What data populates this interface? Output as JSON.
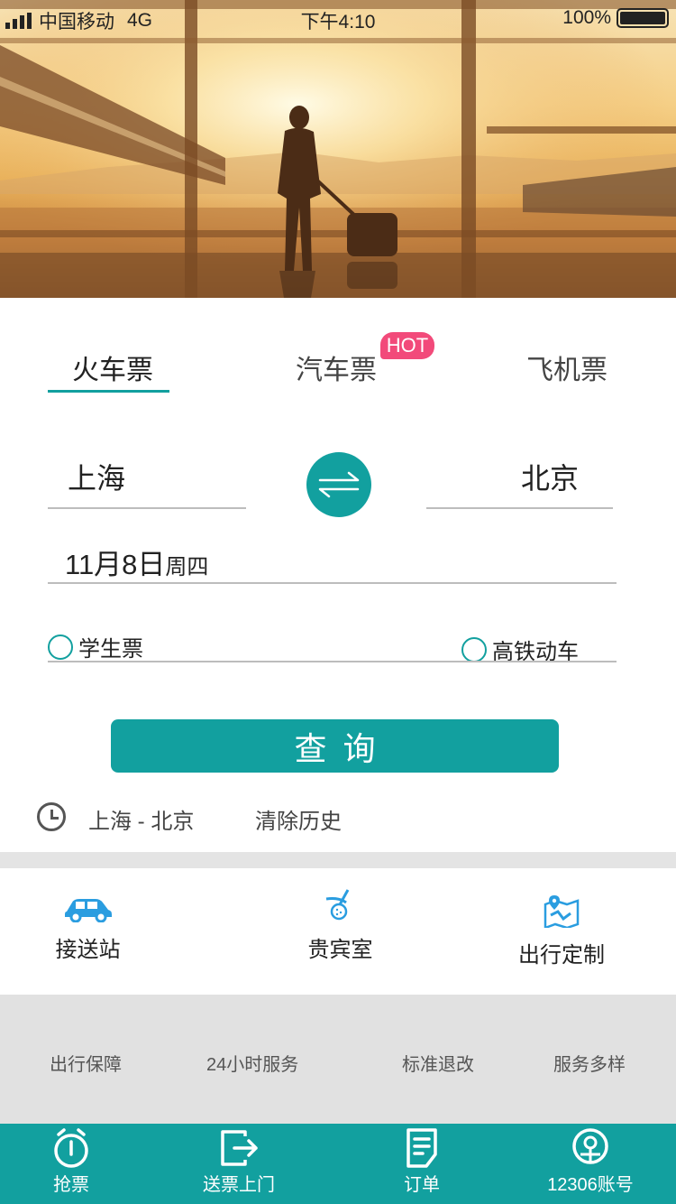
{
  "status": {
    "carrier": "中国移动",
    "network": "4G",
    "time": "下午4:10",
    "battery": "100%"
  },
  "tabs": [
    {
      "label": "火车票"
    },
    {
      "label": "汽车票"
    },
    {
      "label": "飞机票"
    }
  ],
  "hot_badge": "HOT",
  "route": {
    "from": "上海",
    "to": "北京"
  },
  "date": {
    "day": "11月8日",
    "weekday": "周四"
  },
  "options": {
    "student": "学生票",
    "gaotie": "高铁动车"
  },
  "search_label": "查询",
  "history": {
    "route": "上海 - 北京",
    "clear": "清除历史"
  },
  "services": [
    {
      "label": "接送站",
      "icon": "car-icon"
    },
    {
      "label": "贵宾室",
      "icon": "golf-icon"
    },
    {
      "label": "出行定制",
      "icon": "map-icon"
    }
  ],
  "features": [
    "出行保障",
    "24小时服务",
    "标准退改",
    "服务多样"
  ],
  "tabbar": [
    {
      "label": "抢票",
      "icon": "alarm-clock-icon"
    },
    {
      "label": "送票上门",
      "icon": "exit-icon"
    },
    {
      "label": "订单",
      "icon": "document-icon"
    },
    {
      "label": "12306账号",
      "icon": "railway-logo-icon"
    }
  ],
  "colors": {
    "accent": "#12a09f",
    "hot": "#f24a7a"
  }
}
